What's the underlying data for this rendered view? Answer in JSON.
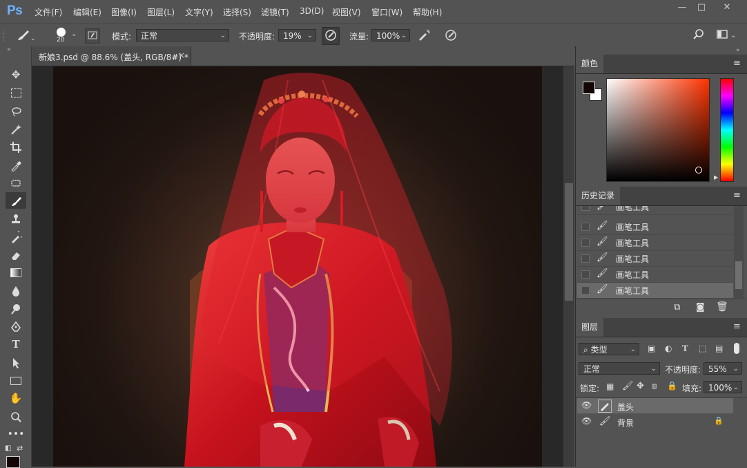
{
  "app": {
    "logo": "Ps"
  },
  "menu": {
    "items": [
      "文件(F)",
      "编辑(E)",
      "图像(I)",
      "图层(L)",
      "文字(Y)",
      "选择(S)",
      "滤镜(T)",
      "3D(D)",
      "视图(V)",
      "窗口(W)",
      "帮助(H)"
    ]
  },
  "window_controls": {
    "minimize": "—",
    "maximize": "□",
    "close": "✕"
  },
  "options": {
    "brush_size": "20",
    "mode_label": "模式:",
    "mode_value": "正常",
    "opacity_label": "不透明度:",
    "opacity_value": "19%",
    "flow_label": "流量:",
    "flow_value": "100%"
  },
  "document": {
    "tab_title": "新娘3.psd @ 88.6% (盖头, RGB/8#) *",
    "tab_close": "×"
  },
  "panels": {
    "color": {
      "tab": "颜色",
      "foreground": "#140604",
      "background": "#ffffff",
      "hue": "#ff3300"
    },
    "history": {
      "tab": "历史记录",
      "items": [
        {
          "label": "画笔工具"
        },
        {
          "label": "画笔工具"
        },
        {
          "label": "画笔工具"
        },
        {
          "label": "画笔工具"
        },
        {
          "label": "画笔工具"
        },
        {
          "label": "画笔工具"
        }
      ]
    },
    "layers": {
      "tab": "图层",
      "filter_kind": "类型",
      "blend_mode": "正常",
      "opacity_label": "不透明度:",
      "opacity_value": "55%",
      "lock_label": "锁定:",
      "fill_label": "填充:",
      "fill_value": "100%",
      "items": [
        {
          "name": "盖头",
          "selected": true
        },
        {
          "name": "背景",
          "selected": false
        }
      ]
    }
  }
}
